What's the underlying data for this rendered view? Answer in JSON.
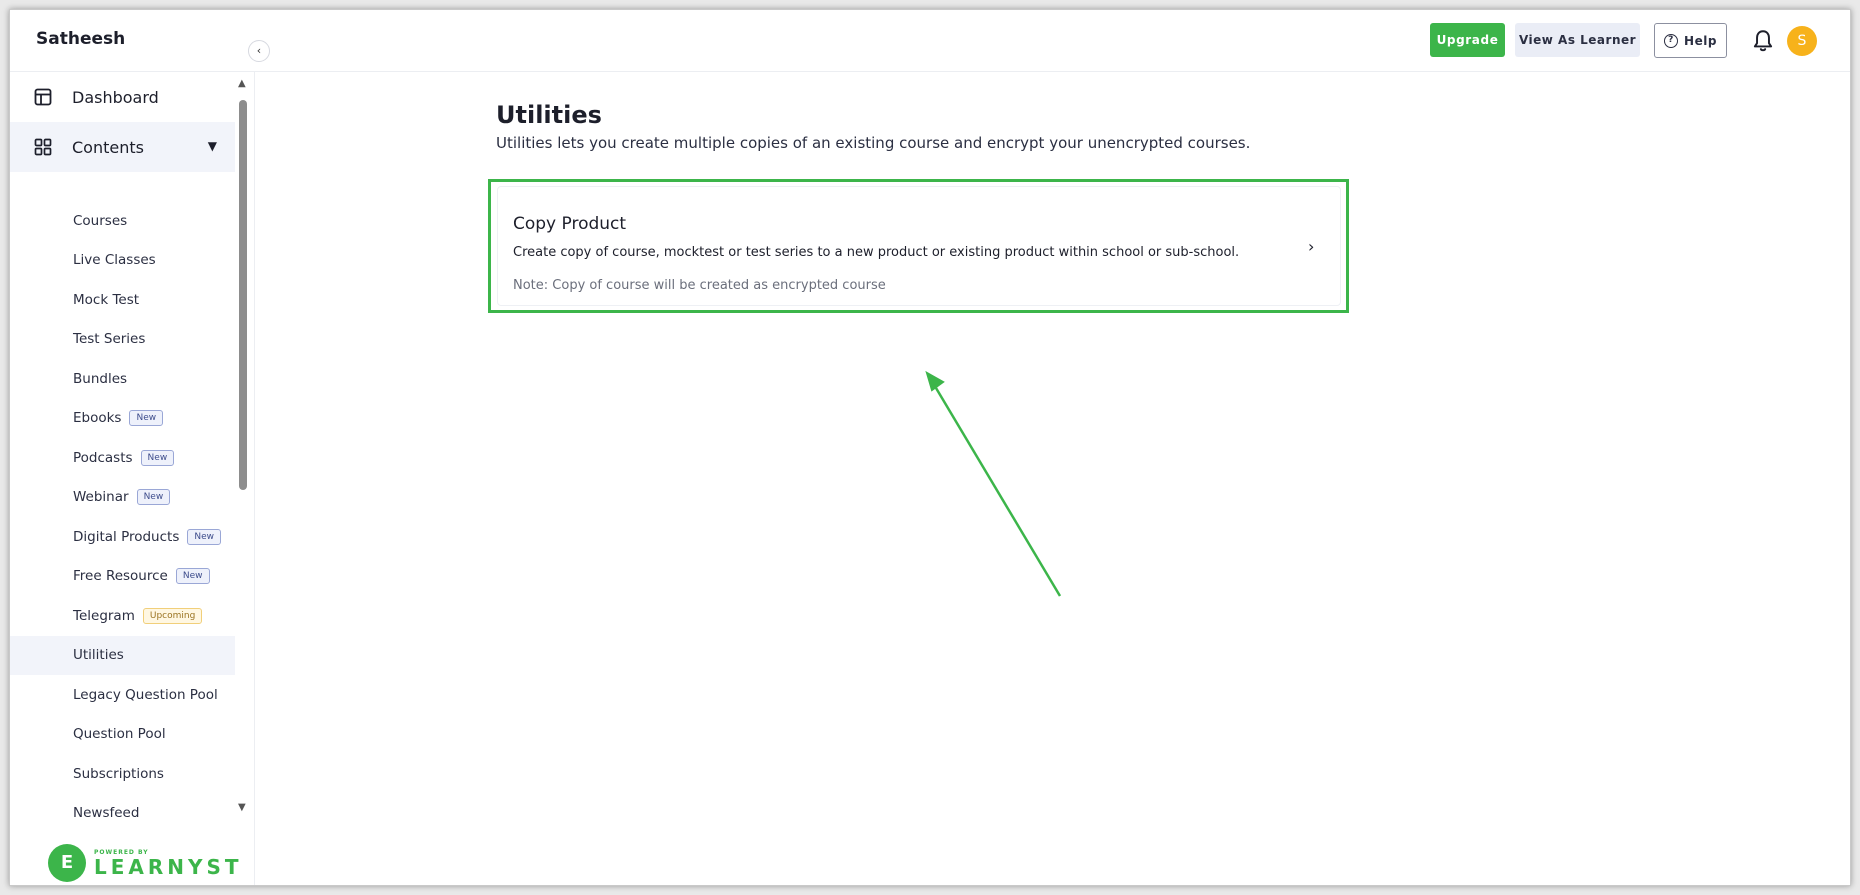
{
  "header": {
    "school_name": "Satheesh",
    "upgrade_label": "Upgrade",
    "view_as_learner_label": "View As Learner",
    "help_label": "Help",
    "avatar_initial": "S",
    "accent_color": "#3cb54a"
  },
  "sidebar": {
    "dashboard_label": "Dashboard",
    "contents_label": "Contents",
    "items": [
      {
        "label": "Courses",
        "badge": ""
      },
      {
        "label": "Live Classes",
        "badge": ""
      },
      {
        "label": "Mock Test",
        "badge": ""
      },
      {
        "label": "Test Series",
        "badge": ""
      },
      {
        "label": "Bundles",
        "badge": ""
      },
      {
        "label": "Ebooks",
        "badge": "New"
      },
      {
        "label": "Podcasts",
        "badge": "New"
      },
      {
        "label": "Webinar",
        "badge": "New"
      },
      {
        "label": "Digital Products",
        "badge": "New"
      },
      {
        "label": "Free Resource",
        "badge": "New"
      },
      {
        "label": "Telegram",
        "badge": "Upcoming"
      },
      {
        "label": "Utilities",
        "badge": "",
        "active": true
      },
      {
        "label": "Legacy Question Pool",
        "badge": ""
      },
      {
        "label": "Question Pool",
        "badge": ""
      },
      {
        "label": "Subscriptions",
        "badge": ""
      },
      {
        "label": "Newsfeed",
        "badge": ""
      }
    ],
    "powered_by": "POWERED BY",
    "brand": "LEARNYST"
  },
  "main": {
    "title": "Utilities",
    "description": "Utilities lets you create multiple copies of an existing course and encrypt your unencrypted courses.",
    "card": {
      "title": "Copy Product",
      "description": "Create copy of course, mocktest or test series to a new product or existing product within school or sub-school.",
      "note": "Note: Copy of course will be created as encrypted course"
    }
  }
}
